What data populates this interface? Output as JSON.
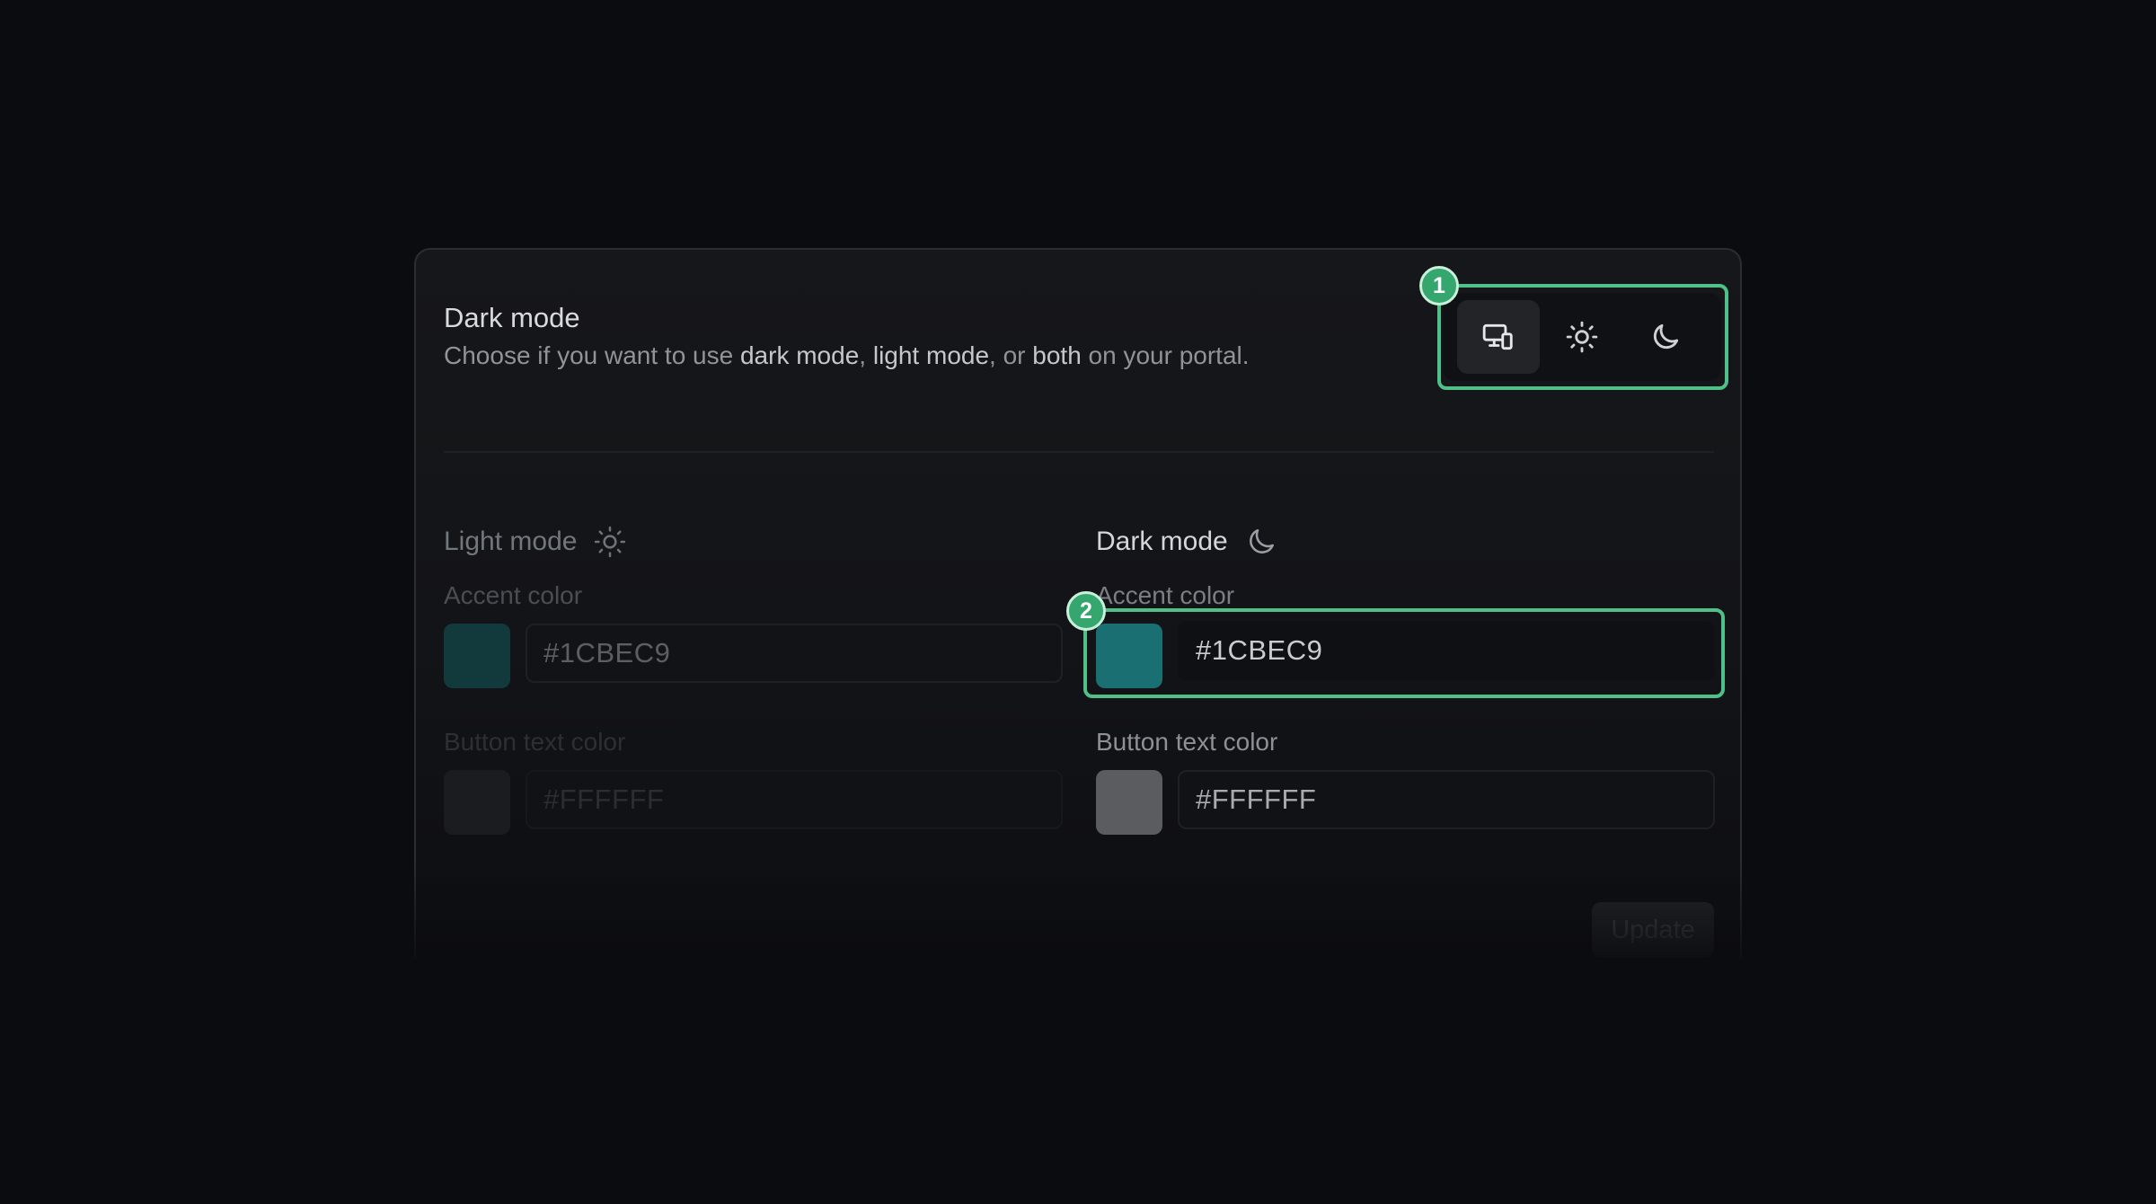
{
  "section": {
    "title": "Dark mode",
    "description_prefix": "Choose if you want to use ",
    "description_dark": "dark mode",
    "description_sep1": ", ",
    "description_light": "light mode",
    "description_sep2": ", or ",
    "description_both": "both",
    "description_suffix": " on your portal."
  },
  "theme_toggle": {
    "options": [
      {
        "icon": "monitor-phone-icon",
        "selected": true
      },
      {
        "icon": "sun-icon",
        "selected": false
      },
      {
        "icon": "moon-icon",
        "selected": false
      }
    ]
  },
  "annotations": {
    "badge_1": "1",
    "badge_2": "2",
    "color": "#4ec088"
  },
  "light_mode": {
    "heading": "Light mode",
    "icon": "sun-icon",
    "accent_label": "Accent color",
    "accent_value": "#1CBEC9",
    "button_text_label": "Button text color",
    "button_text_value": "#FFFFFF"
  },
  "dark_mode": {
    "heading": "Dark mode",
    "icon": "moon-icon",
    "accent_label": "Accent color",
    "accent_value": "#1CBEC9",
    "button_text_label": "Button text color",
    "button_text_value": "#FFFFFF"
  },
  "actions": {
    "update_label": "Update"
  }
}
